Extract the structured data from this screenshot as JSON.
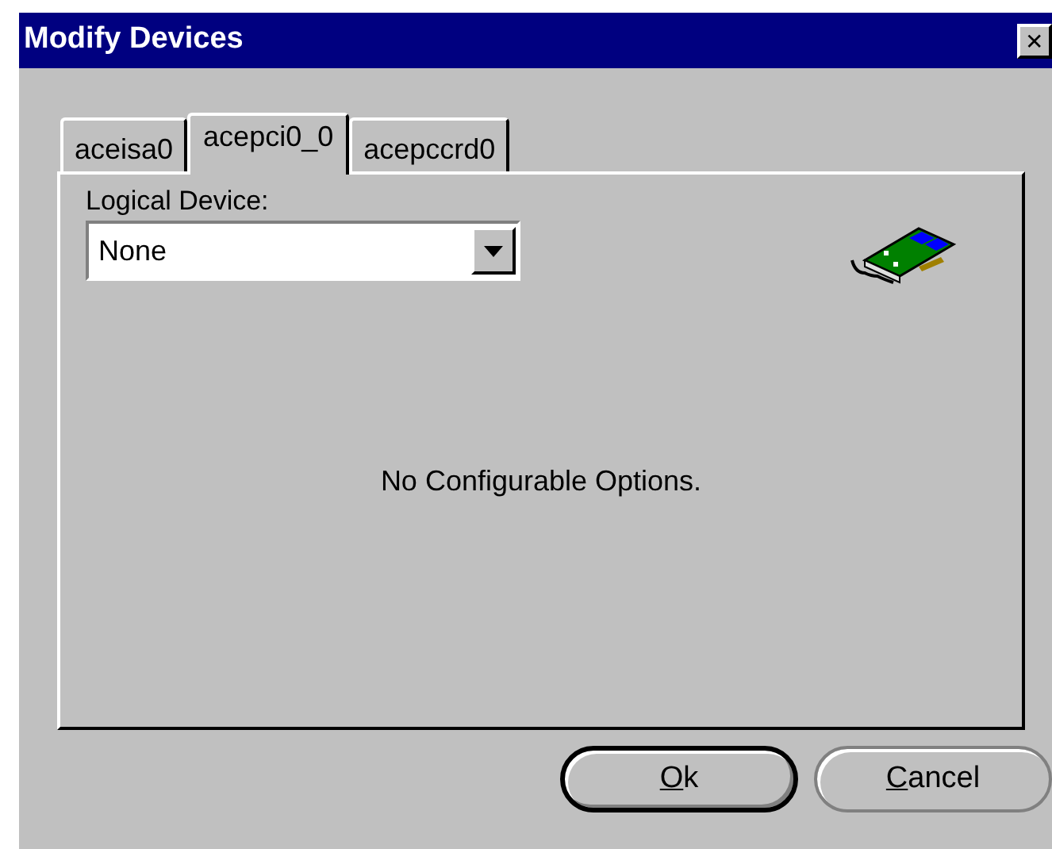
{
  "window": {
    "title": "Modify Devices",
    "close_glyph": "✕"
  },
  "tabs": [
    {
      "label": "aceisa0",
      "selected": false
    },
    {
      "label": "acepci0_0",
      "selected": true
    },
    {
      "label": "acepccrd0",
      "selected": false
    }
  ],
  "logical_device": {
    "label": "Logical Device:",
    "value": "None"
  },
  "message": "No Configurable Options.",
  "buttons": [
    {
      "underlined": "O",
      "rest": "k",
      "default": true
    },
    {
      "underlined": "C",
      "rest": "ancel",
      "default": false
    }
  ]
}
